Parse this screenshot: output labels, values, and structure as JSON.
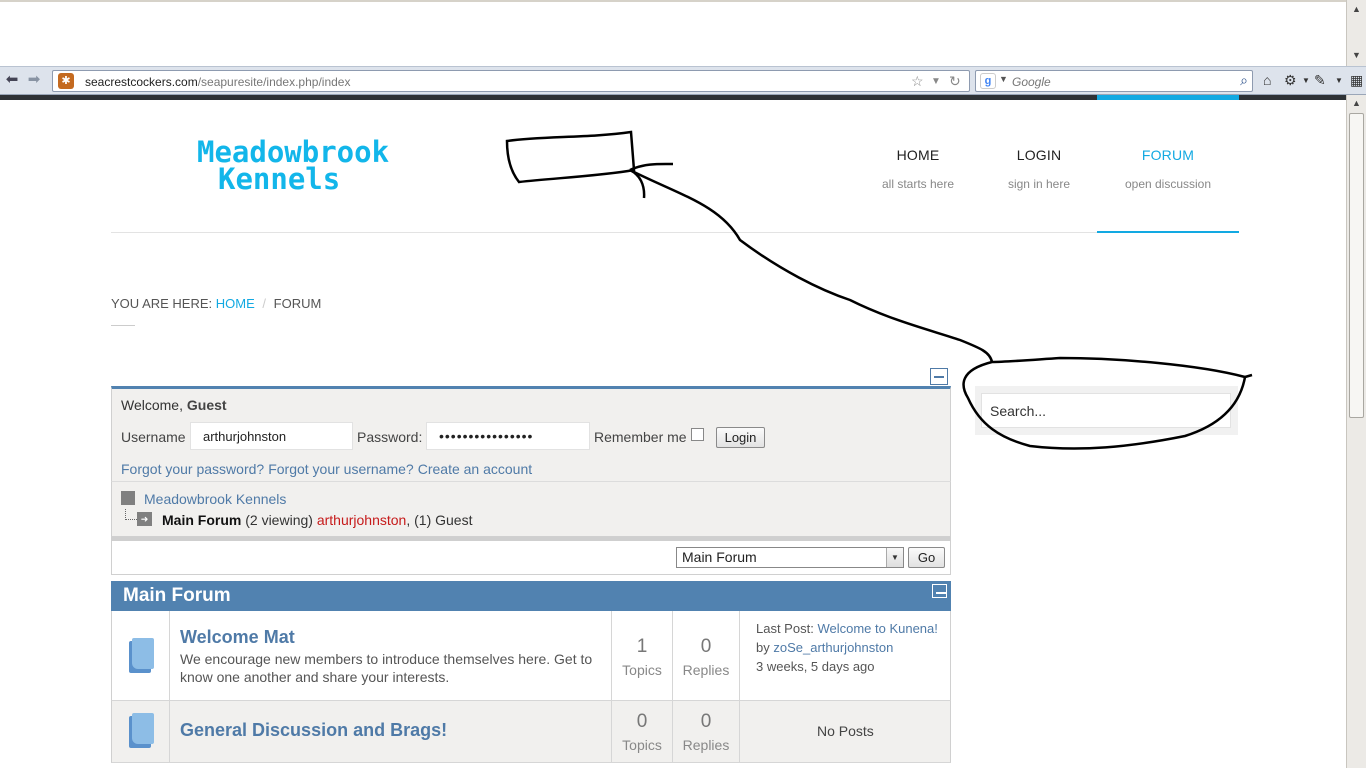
{
  "browser": {
    "url_domain": "seacrestcockers.com",
    "url_path": "/seapuresite/index.php/index",
    "search_placeholder": "Google"
  },
  "site": {
    "logo_line1": "Meadowbrook",
    "logo_line2": "Kennels",
    "accent_color": "#12a9e2",
    "nav": [
      {
        "title": "HOME",
        "subtitle": "all starts here"
      },
      {
        "title": "LOGIN",
        "subtitle": "sign in here"
      },
      {
        "title": "FORUM",
        "subtitle": "open discussion"
      }
    ],
    "active_nav": "FORUM"
  },
  "breadcrumb": {
    "prefix": "YOU ARE HERE:",
    "home": "HOME",
    "separator": "/",
    "current": "FORUM"
  },
  "login": {
    "welcome_prefix": "Welcome,",
    "welcome_user": "Guest",
    "username_label": "Username",
    "username_value": "arthurjohnston",
    "password_label": "Password:",
    "password_value": "••••••••••••••••",
    "remember_label": "Remember me",
    "remember_checked": false,
    "login_button": "Login",
    "forgot_password": "Forgot your password?",
    "forgot_username": "Forgot your username?",
    "create_account": "Create an account"
  },
  "stats": {
    "site_name": "Meadowbrook Kennels",
    "forum_name": "Main Forum",
    "viewing": "(2 viewing)",
    "user": "arthurjohnston",
    "guests": ", (1) Guest"
  },
  "jump": {
    "selected": "Main Forum",
    "go_button": "Go"
  },
  "forum": {
    "header": "Main Forum",
    "header_color": "#5182b0",
    "categories": [
      {
        "title": "Welcome Mat",
        "description": "We encourage new members to introduce themselves here. Get to know one another and share your interests.",
        "topics": "1",
        "topics_label": "Topics",
        "replies": "0",
        "replies_label": "Replies",
        "last_post_label": "Last Post:",
        "last_post_title": "Welcome to Kunena!",
        "by_label": "by",
        "last_post_author": "zoSe_arthurjohnston",
        "last_post_time": "3 weeks, 5 days ago"
      },
      {
        "title": "General Discussion and Brags!",
        "topics": "0",
        "topics_label": "Topics",
        "replies": "0",
        "replies_label": "Replies",
        "no_posts": "No Posts"
      }
    ]
  },
  "sidebar": {
    "search_placeholder": "Search..."
  }
}
